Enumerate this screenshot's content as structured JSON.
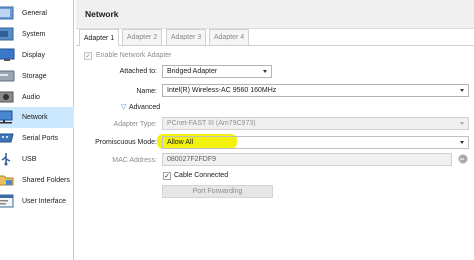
{
  "sidebar": {
    "items": [
      {
        "label": "General",
        "icon": "general-icon"
      },
      {
        "label": "System",
        "icon": "system-icon"
      },
      {
        "label": "Display",
        "icon": "display-icon"
      },
      {
        "label": "Storage",
        "icon": "storage-icon"
      },
      {
        "label": "Audio",
        "icon": "audio-icon"
      },
      {
        "label": "Network",
        "icon": "network-icon"
      },
      {
        "label": "Serial Ports",
        "icon": "serial-ports-icon"
      },
      {
        "label": "USB",
        "icon": "usb-icon"
      },
      {
        "label": "Shared Folders",
        "icon": "shared-folders-icon"
      },
      {
        "label": "User Interface",
        "icon": "user-interface-icon"
      }
    ],
    "selected": "Network"
  },
  "header": {
    "title": "Network"
  },
  "tabs": [
    {
      "label": "Adapter 1"
    },
    {
      "label": "Adapter 2"
    },
    {
      "label": "Adapter 3"
    },
    {
      "label": "Adapter 4"
    }
  ],
  "adapter": {
    "enable_label": "Enable Network Adapter",
    "enable_checked": true,
    "attached_label": "Attached to:",
    "attached_value": "Bridged Adapter",
    "name_label": "Name:",
    "name_value": "Intel(R) Wireless-AC 9560 160MHz",
    "advanced_label": "Advanced",
    "adapter_type_label": "Adapter Type:",
    "adapter_type_value": "PCnet-FAST III (Am79C973)",
    "promiscuous_label": "Promiscuous Mode:",
    "promiscuous_value": "Allow All",
    "mac_label": "MAC Address:",
    "mac_value": "080027F2FDF9",
    "cable_label": "Cable Connected",
    "cable_checked": true,
    "port_forwarding_label": "Port Forwarding"
  },
  "colors": {
    "selection": "#cce8ff",
    "highlight": "#f2f20e",
    "accent": "#3a7bd5"
  }
}
